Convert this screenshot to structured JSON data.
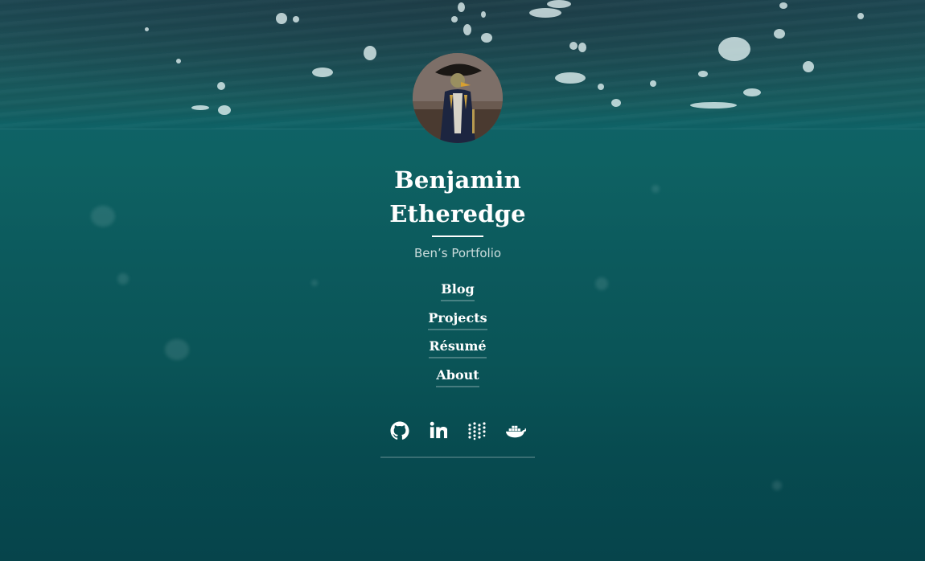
{
  "profile": {
    "name_line1": "Benjamin",
    "name_line2": "Etheredge",
    "tagline": "Ben’s Portfolio"
  },
  "nav": {
    "items": [
      {
        "label": "Blog"
      },
      {
        "label": "Projects"
      },
      {
        "label": "Résumé"
      },
      {
        "label": "About"
      }
    ]
  },
  "social": {
    "icons": [
      "github-icon",
      "linkedin-icon",
      "meetup-dots-icon",
      "docker-icon"
    ]
  },
  "colors": {
    "water_top": "#1d4a55",
    "water_mid": "#0e6263",
    "water_bottom": "#06444b",
    "text": "#ffffff"
  }
}
